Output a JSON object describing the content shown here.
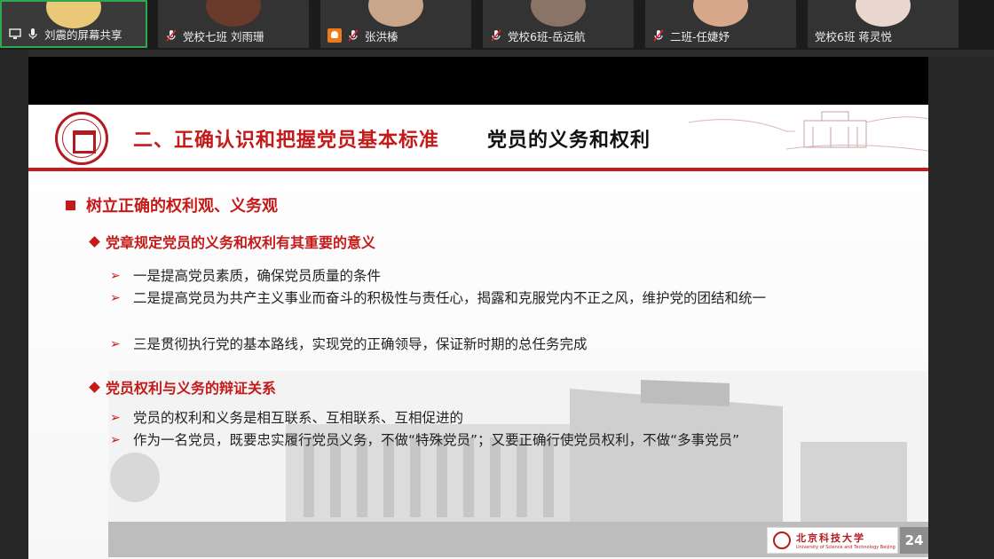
{
  "participants": [
    {
      "name": "刘震的屏幕共享",
      "status": "sharing",
      "avatar_color": "#e9c978"
    },
    {
      "name": "党校七班 刘雨珊",
      "status": "muted",
      "avatar_color": "#6a3b2a"
    },
    {
      "name": "张洪榛",
      "status": "muted",
      "avatar_color": "#c9a68a"
    },
    {
      "name": "党校6班-岳远航",
      "status": "muted",
      "avatar_color": "#8a7466"
    },
    {
      "name": "二班-任婕妤",
      "status": "muted",
      "avatar_color": "#d8a88c"
    },
    {
      "name": "党校6班 蒋灵悦",
      "status": "unmuted",
      "avatar_color": "#e8d6cf"
    }
  ],
  "slide": {
    "title_red": "二、正确认识和把握党员基本标准",
    "title_black": "党员的义务和权利",
    "heading": "树立正确的权利观、义务观",
    "section1": {
      "title": "党章规定党员的义务和权利有其重要的意义",
      "bullets": [
        "一是提高党员素质，确保党员质量的条件",
        "二是提高党员为共产主义事业而奋斗的积极性与责任心，揭露和克服党内不正之风，维护党的团结和统一",
        "三是贯彻执行党的基本路线，实现党的正确领导，保证新时期的总任务完成"
      ]
    },
    "section2": {
      "title": "党员权利与义务的辩证关系",
      "bullets": [
        "党员的权利和义务是相互联系、互相联系、互相促进的",
        "作为一名党员，既要忠实履行党员义务，不做“特殊党员”；又要正确行使党员权利，不做“多事党员”"
      ]
    },
    "footer_logo_cn": "北京科技大学",
    "footer_logo_en": "University of Science and Technology Beijing",
    "page_number": "24",
    "accent_color": "#c41a1a"
  }
}
